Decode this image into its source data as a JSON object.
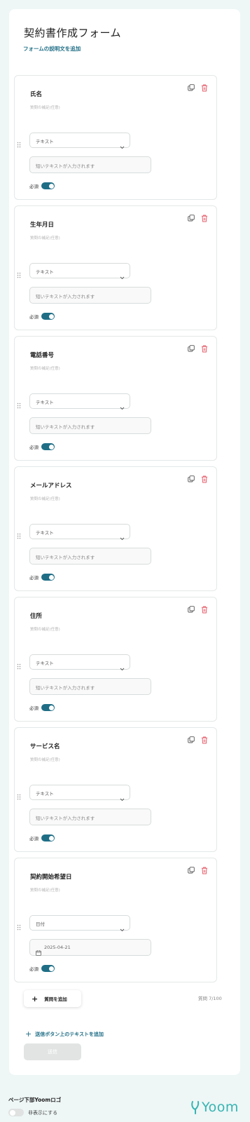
{
  "form": {
    "title": "契約書作成フォーム",
    "description_link": "フォームの説明文を追加"
  },
  "questions": [
    {
      "title": "氏名",
      "subtitle": "質問の補足(任意)",
      "type": "テキスト",
      "placeholder": "短いテキストが入力されます",
      "required_label": "必須",
      "required": true,
      "field_kind": "text"
    },
    {
      "title": "生年月日",
      "subtitle": "質問の補足(任意)",
      "type": "テキスト",
      "placeholder": "短いテキストが入力されます",
      "required_label": "必須",
      "required": true,
      "field_kind": "text"
    },
    {
      "title": "電話番号",
      "subtitle": "質問の補足(任意)",
      "type": "テキスト",
      "placeholder": "短いテキストが入力されます",
      "required_label": "必須",
      "required": true,
      "field_kind": "text"
    },
    {
      "title": "メールアドレス",
      "subtitle": "質問の補足(任意)",
      "type": "テキスト",
      "placeholder": "短いテキストが入力されます",
      "required_label": "必須",
      "required": true,
      "field_kind": "text"
    },
    {
      "title": "住所",
      "subtitle": "質問の補足(任意)",
      "type": "テキスト",
      "placeholder": "短いテキストが入力されます",
      "required_label": "必須",
      "required": true,
      "field_kind": "text"
    },
    {
      "title": "サービス名",
      "subtitle": "質問の補足(任意)",
      "type": "テキスト",
      "placeholder": "短いテキストが入力されます",
      "required_label": "必須",
      "required": true,
      "field_kind": "text"
    },
    {
      "title": "契約開始希望日",
      "subtitle": "質問の補足(任意)",
      "type": "日付",
      "placeholder": "2025-04-21",
      "required_label": "必須",
      "required": true,
      "field_kind": "date"
    }
  ],
  "actions": {
    "add_question": "質問を追加",
    "question_count": "質問 7/100",
    "add_submit_text": "送信ボタン上のテキストを追加",
    "submit": "送信"
  },
  "footer": {
    "logo_setting_label": "ページ下部Yoomロゴ",
    "hide_label": "非表示にする",
    "hide_enabled": false,
    "logo_text": "Yoom"
  },
  "colors": {
    "accent": "#1f6e86",
    "delete": "#e35d6a",
    "logo": "#36b5b2",
    "background": "#eef6f6"
  },
  "icons": {
    "duplicate": "duplicate-icon",
    "delete": "trash-icon",
    "drag": "drag-handle-icon",
    "chevron": "chevron-down-icon",
    "calendar": "calendar-icon",
    "plus": "plus-icon"
  }
}
